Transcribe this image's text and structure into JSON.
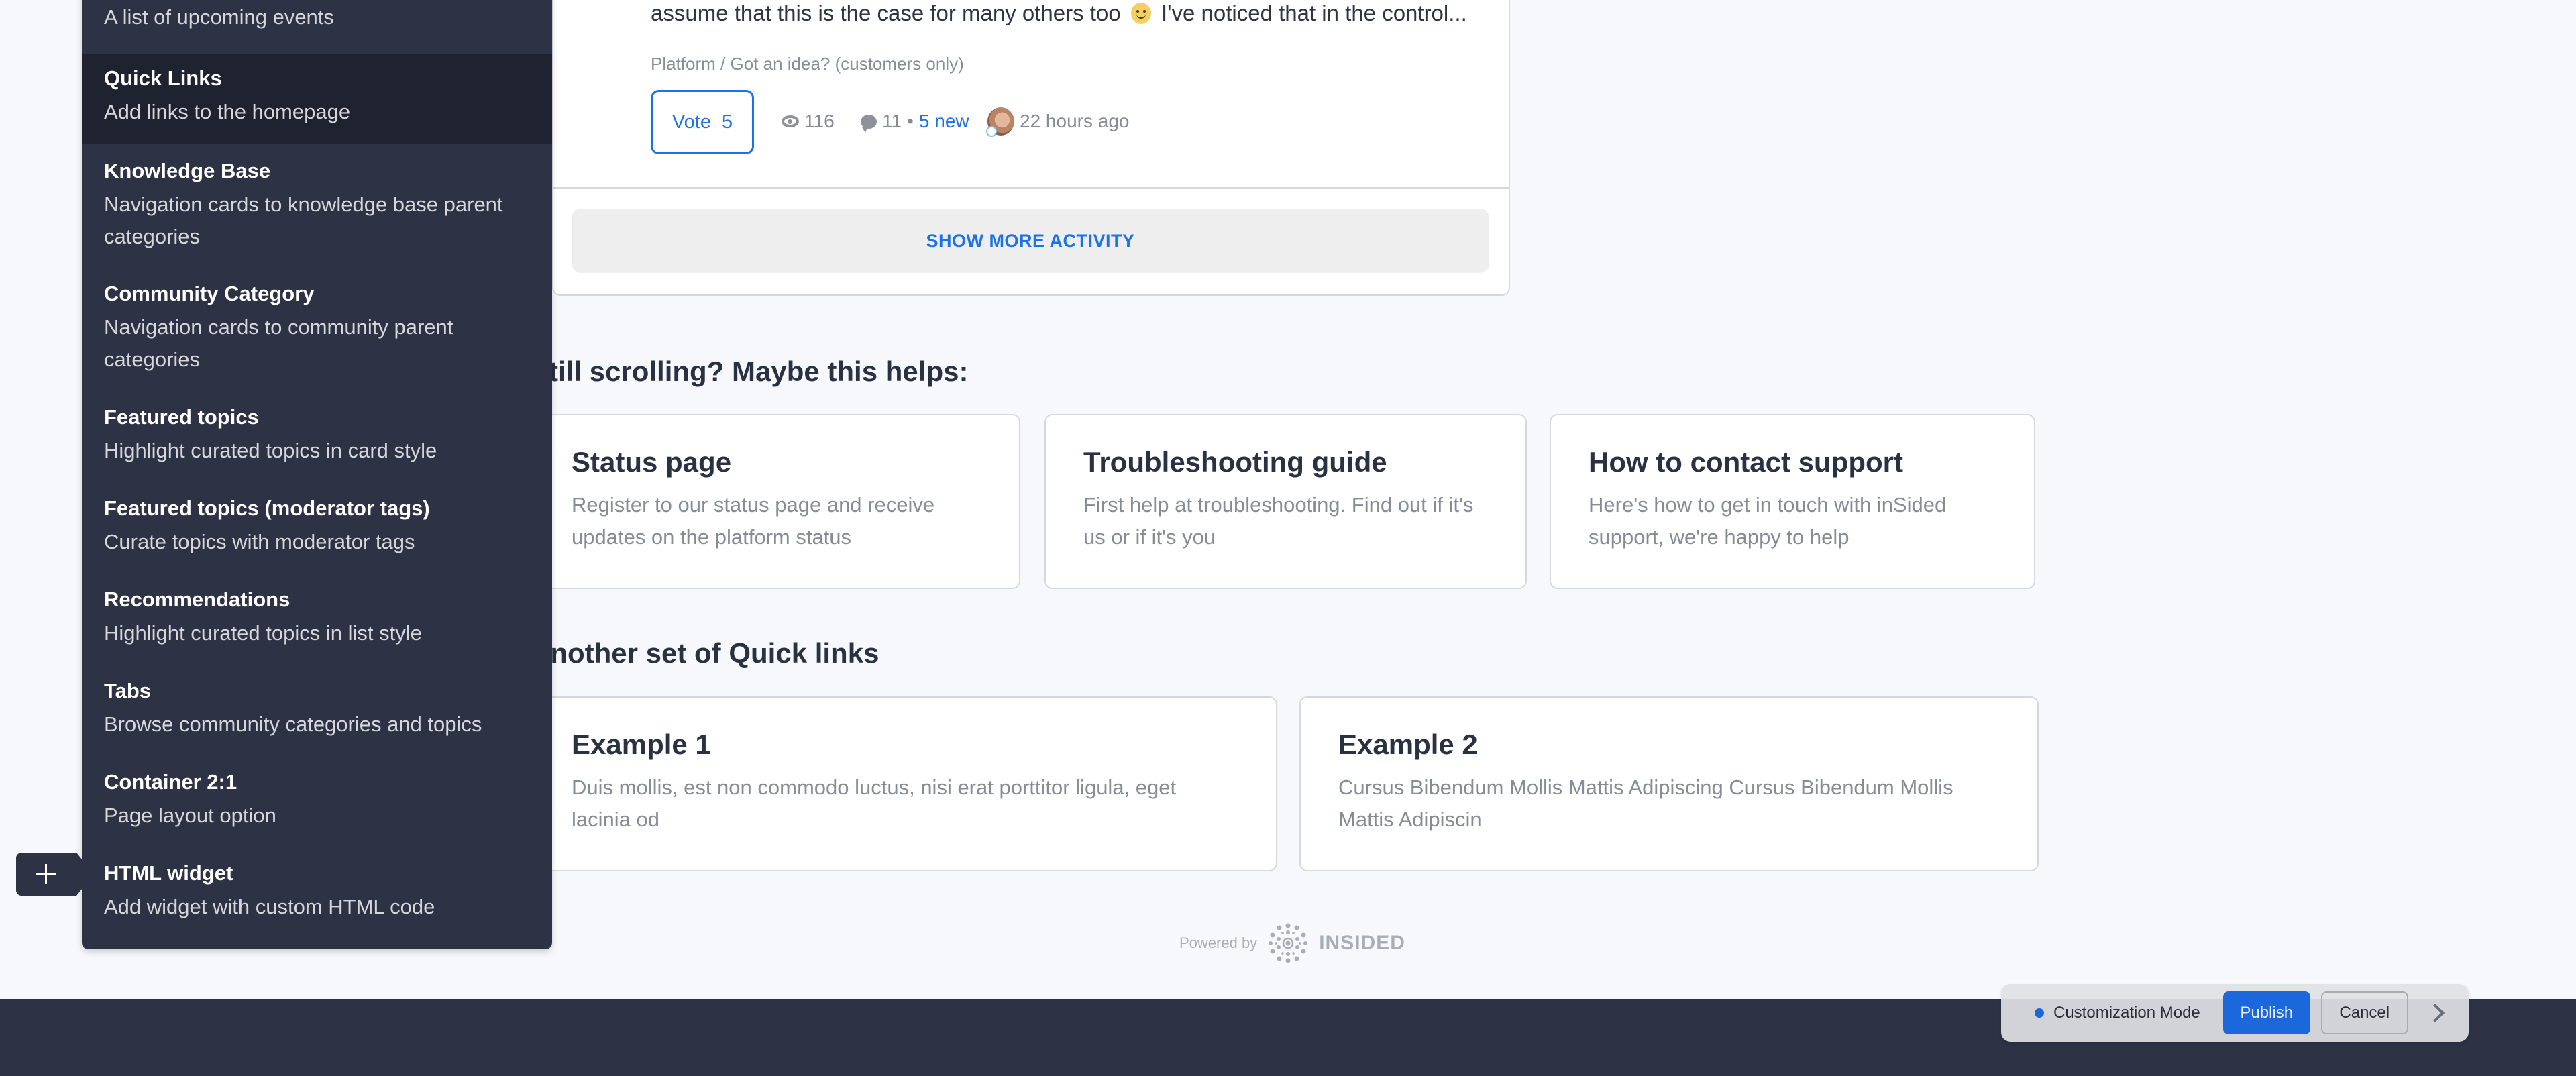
{
  "activity": {
    "excerpt_before": "assume that this is the case for many others too",
    "excerpt_after": "I've noticed that in the control...",
    "breadcrumb": "Platform / Got an idea? (customers only)",
    "vote_label": "Vote",
    "vote_count": "5",
    "views": "116",
    "replies": "11",
    "separator": "•",
    "new_replies": "5 new",
    "time_ago": "22 hours ago",
    "show_more": "SHOW MORE ACTIVITY"
  },
  "helps": {
    "heading": "Still scrolling? Maybe this helps:",
    "cards": [
      {
        "title": "Status page",
        "desc": "Register to our status page and receive updates on the platform status"
      },
      {
        "title": "Troubleshooting guide",
        "desc": "First help at troubleshooting. Find out if it's us or if it's you"
      },
      {
        "title": "How to contact support",
        "desc": "Here's how to get in touch with inSided support, we're happy to help"
      }
    ]
  },
  "quicklinks": {
    "heading": "Another set of Quick links",
    "cards": [
      {
        "title": "Example 1",
        "desc": "Duis mollis, est non commodo luctus, nisi erat porttitor ligula, eget lacinia od"
      },
      {
        "title": "Example 2",
        "desc": "Cursus Bibendum Mollis Mattis Adipiscing Cursus Bibendum Mollis Mattis Adipiscin"
      }
    ]
  },
  "powered": {
    "label": "Powered by",
    "brand": "INSIDED"
  },
  "sidebar": {
    "items": [
      {
        "title": "",
        "desc": "A list of upcoming events"
      },
      {
        "title": "Quick Links",
        "desc": "Add links to the homepage",
        "active": true
      },
      {
        "title": "Knowledge Base",
        "desc": "Navigation cards to knowledge base parent categories"
      },
      {
        "title": "Community Category",
        "desc": "Navigation cards to community parent categories"
      },
      {
        "title": "Featured topics",
        "desc": "Highlight curated topics in card style"
      },
      {
        "title": "Featured topics (moderator tags)",
        "desc": "Curate topics with moderator tags"
      },
      {
        "title": "Recommendations",
        "desc": "Highlight curated topics in list style"
      },
      {
        "title": "Tabs",
        "desc": "Browse community categories and topics"
      },
      {
        "title": "Container 2:1",
        "desc": "Page layout option"
      },
      {
        "title": "HTML widget",
        "desc": "Add widget with custom HTML code"
      }
    ]
  },
  "customization": {
    "mode_label": "Customization Mode",
    "publish": "Publish",
    "cancel": "Cancel",
    "status_color": "#1a66da"
  },
  "colors": {
    "accent": "#1d72e8",
    "panel": "#2d3244",
    "background": "#f7f8fc"
  }
}
